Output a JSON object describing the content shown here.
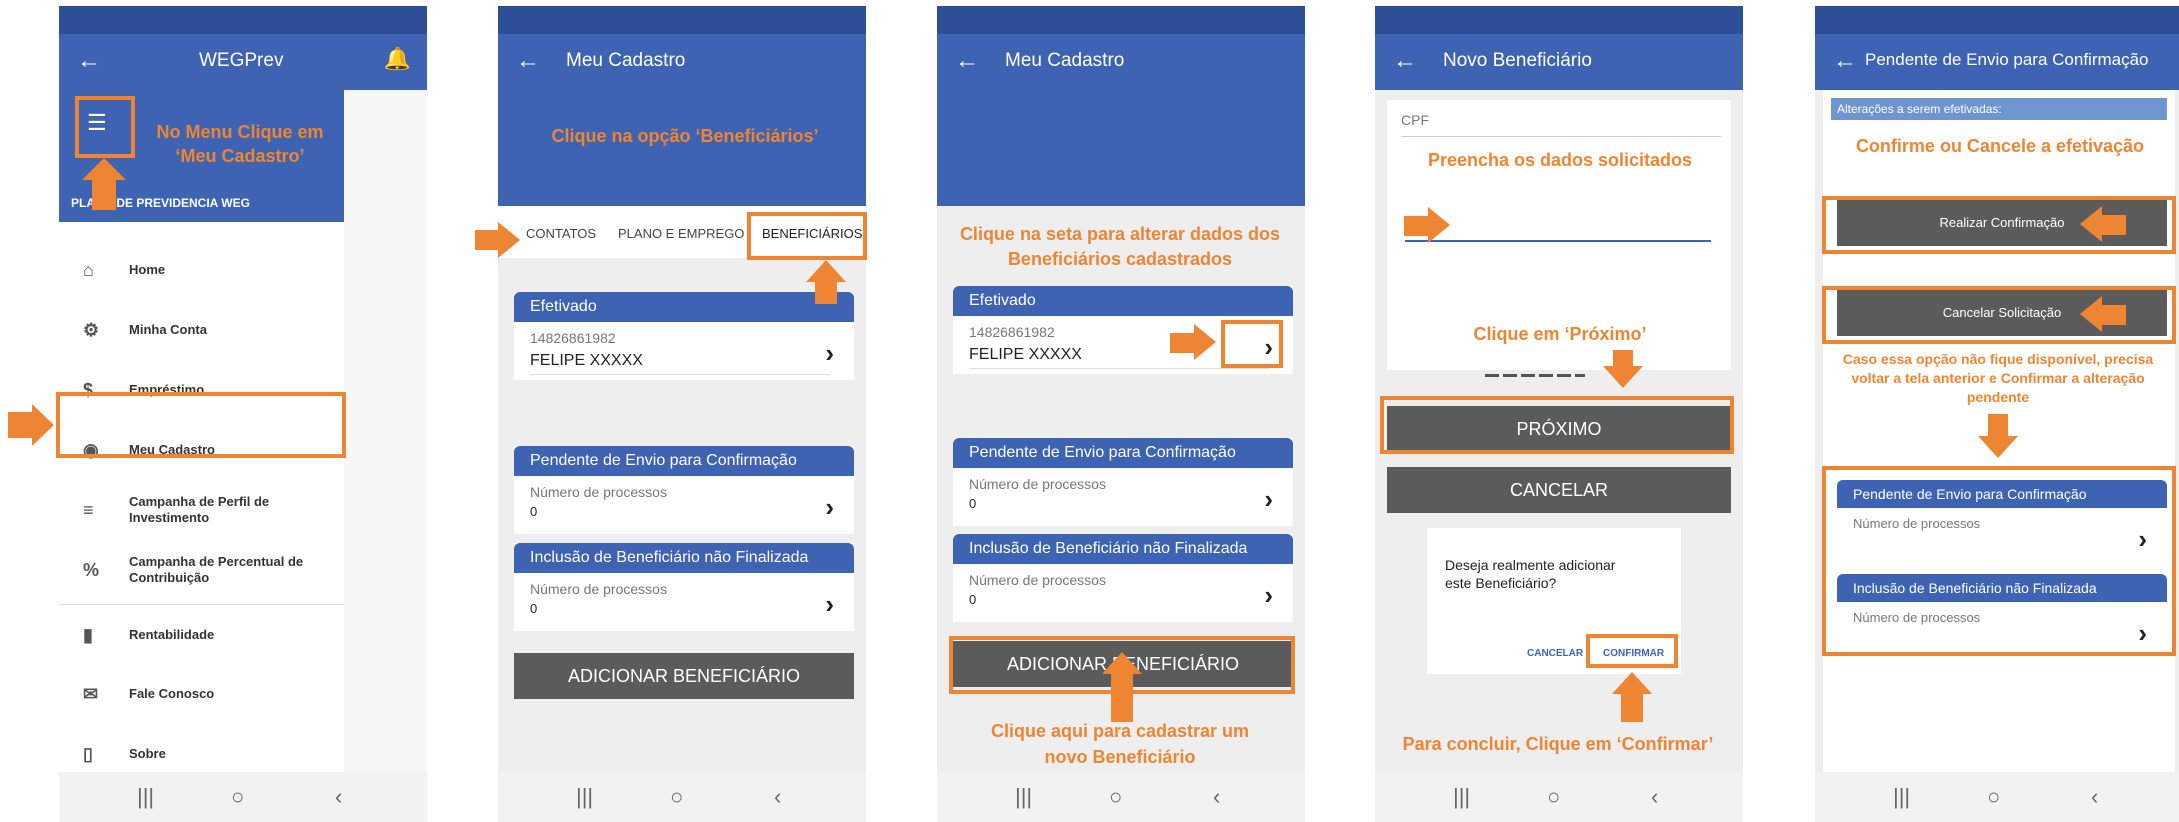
{
  "colors": {
    "accent": "#ee8533",
    "primary": "#3e63b2",
    "status": "#2d4f97",
    "button": "#5b5b5b"
  },
  "screen1": {
    "title": "WEGPrev",
    "section": "PLANO DE PREVIDENCIA WEG",
    "note": "No Menu Clique em ‘Meu Cadastro’",
    "menu": [
      {
        "label": "Home",
        "icon": "home-icon"
      },
      {
        "label": "Minha Conta",
        "icon": "account-settings-icon"
      },
      {
        "label": "Empréstimo",
        "icon": "dollar-icon"
      },
      {
        "label": "Meu Cadastro",
        "icon": "user-circle-icon"
      },
      {
        "label": "Campanha de Perfil de Investimento",
        "icon": "list-edit-icon"
      },
      {
        "label": "Campanha de Percentual de Contribuição",
        "icon": "percent-doc-icon"
      },
      {
        "label": "Rentabilidade",
        "icon": "bar-chart-icon"
      },
      {
        "label": "Fale Conosco",
        "icon": "contact-icon"
      },
      {
        "label": "Sobre",
        "icon": "phone-icon"
      }
    ]
  },
  "screen2": {
    "title": "Meu Cadastro",
    "note": "Clique na opção ‘Beneficiários’",
    "tabs": [
      "CONTATOS",
      "PLANO E EMPREGO",
      "BENEFICIÁRIOS"
    ],
    "card1": {
      "header": "Efetivado",
      "id": "14826861982",
      "name": "FELIPE XXXXX"
    },
    "card2": {
      "header": "Pendente de Envio para Confirmação",
      "label": "Número de processos",
      "value": "0"
    },
    "card3": {
      "header": "Inclusão de Beneficiário não Finalizada",
      "label": "Número de processos",
      "value": "0"
    },
    "button": "ADICIONAR BENEFICIÁRIO"
  },
  "screen3": {
    "title": "Meu Cadastro",
    "note_top": "Clique na seta para alterar dados dos Beneficiários cadastrados",
    "note_bottom": "Clique aqui para cadastrar um novo Beneficiário",
    "card1": {
      "header": "Efetivado",
      "id": "14826861982",
      "name": "FELIPE XXXXX"
    },
    "card2": {
      "header": "Pendente de Envio para Confirmação",
      "label": "Número de processos",
      "value": "0"
    },
    "card3": {
      "header": "Inclusão de Beneficiário não Finalizada",
      "label": "Número de processos",
      "value": "0"
    },
    "button": "ADICIONAR BENEFICIÁRIO"
  },
  "screen4": {
    "title": "Novo Beneficiário",
    "field": "CPF",
    "note_fill": "Preencha os dados solicitados",
    "note_next": "Clique em ‘Próximo’",
    "next": "PRÓXIMO",
    "cancel": "CANCELAR",
    "dialog_text": "Deseja realmente adicionar este Beneficiário?",
    "dialog_cancel": "CANCELAR",
    "dialog_confirm": "CONFIRMAR",
    "note_confirm": "Para concluir, Clique em ‘Confirmar’"
  },
  "screen5": {
    "title": "Pendente de Envio para Confirmação",
    "subheader": "Alterações a serem efetivadas:",
    "note_top": "Confirme  ou Cancele a efetivação",
    "btn_confirm": "Realizar Confirmação",
    "btn_cancel": "Cancelar Solicitação",
    "note_mid": "Caso essa opção não fique disponível, precisa voltar a tela anterior e Confirmar a alteração pendente",
    "card1": {
      "header": "Pendente de Envio para Confirmação",
      "label": "Número de processos"
    },
    "card2": {
      "header": "Inclusão de Beneficiário não Finalizada",
      "label": "Número de processos"
    }
  }
}
